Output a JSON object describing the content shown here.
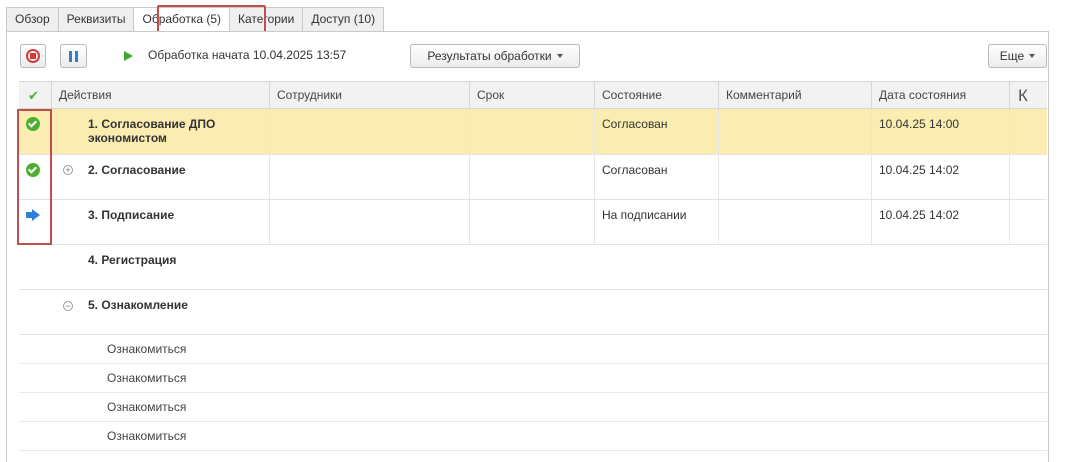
{
  "tabs": [
    {
      "label": "Обзор"
    },
    {
      "label": "Реквизиты"
    },
    {
      "label": "Обработка (5)"
    },
    {
      "label": "Категории"
    },
    {
      "label": "Доступ (10)"
    }
  ],
  "toolbar": {
    "status_text": "Обработка начата 10.04.2025 13:57",
    "results_label": "Результаты обработки",
    "more_label": "Еще"
  },
  "table": {
    "headers": {
      "actions": "Действия",
      "employees": "Сотрудники",
      "deadline": "Срок",
      "state": "Состояние",
      "comment": "Комментарий",
      "state_date": "Дата состояния",
      "k": "К"
    },
    "rows": [
      {
        "title": "1. Согласование ДПО экономистом",
        "state": "Согласован",
        "date": "10.04.25 14:00",
        "icon": "check-circle-icon"
      },
      {
        "title": "2. Согласование",
        "state": "Согласован",
        "date": "10.04.25 14:02",
        "icon": "check-circle-icon"
      },
      {
        "title": "3. Подписание",
        "state": "На подписании",
        "date": "10.04.25 14:02",
        "icon": "arrow-right-icon"
      },
      {
        "title": "4. Регистрация",
        "state": "",
        "date": ""
      },
      {
        "title": "5. Ознакомление",
        "state": "",
        "date": ""
      }
    ],
    "subrows": [
      {
        "label": "Ознакомиться"
      },
      {
        "label": "Ознакомиться"
      },
      {
        "label": "Ознакомиться"
      },
      {
        "label": "Ознакомиться"
      }
    ]
  },
  "colors": {
    "accent_highlight": "#c0504d",
    "selected_row": "#fbedb1",
    "done": "#4caf2f",
    "in_progress": "#2f7fd4",
    "stop": "#d33a3a"
  }
}
